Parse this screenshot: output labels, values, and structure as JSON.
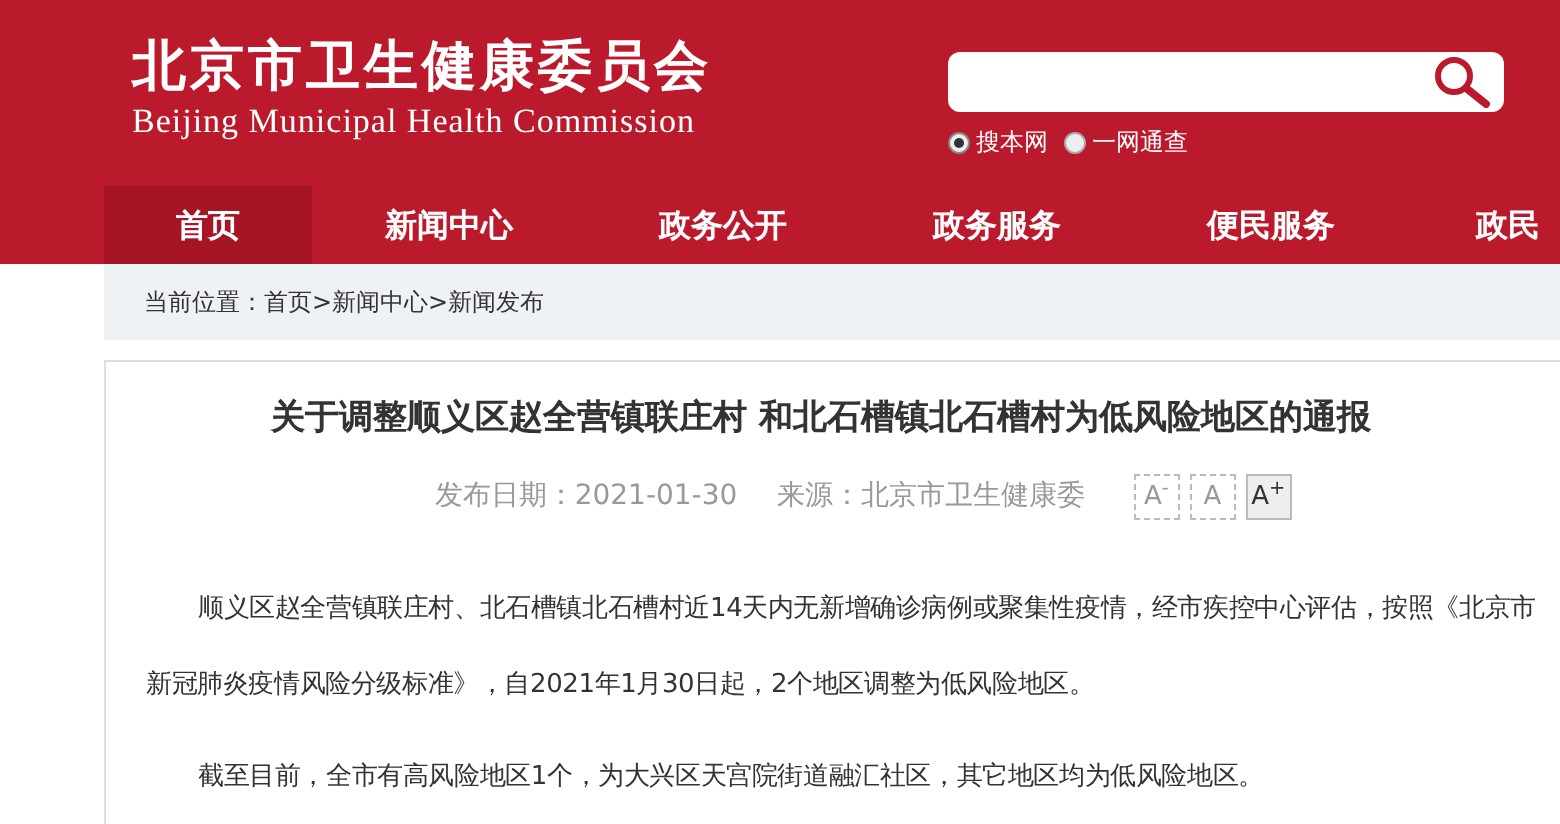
{
  "header": {
    "title": "北京市卫生健康委员会",
    "subtitle": "Beijing Municipal Health Commission"
  },
  "search": {
    "scopes": [
      {
        "label": "搜本网",
        "selected": true
      },
      {
        "label": "一网通查",
        "selected": false
      }
    ]
  },
  "nav": [
    {
      "label": "首页",
      "selected": true
    },
    {
      "label": "新闻中心",
      "selected": false
    },
    {
      "label": "政务公开",
      "selected": false
    },
    {
      "label": "政务服务",
      "selected": false
    },
    {
      "label": "便民服务",
      "selected": false
    },
    {
      "label": "政民",
      "selected": false
    }
  ],
  "breadcrumb": "当前位置：首页>新闻中心>新闻发布",
  "article": {
    "title": "关于调整顺义区赵全营镇联庄村 和北石槽镇北石槽村为低风险地区的通报",
    "date": "发布日期：2021-01-30",
    "source": "来源：北京市卫生健康委",
    "font_sizes": [
      {
        "label": "A$^{-}$",
        "selected": false
      },
      {
        "label": "A",
        "selected": false
      },
      {
        "label": "A$^{+}$",
        "selected": true
      }
    ],
    "paragraphs": [
      "顺义区赵全营镇联庄村、北石槽镇北石槽村近14天内无新增确诊病例或聚集性疫情，经市疾控中心评估，按照《北京市新冠肺炎疫情风险分级标准》，自2021年1月30日起，2个地区调整为低风险地区。",
      "截至目前，全市有高风险地区1个，为大兴区天宫院街道融汇社区，其它地区均为低风险地区。"
    ]
  }
}
